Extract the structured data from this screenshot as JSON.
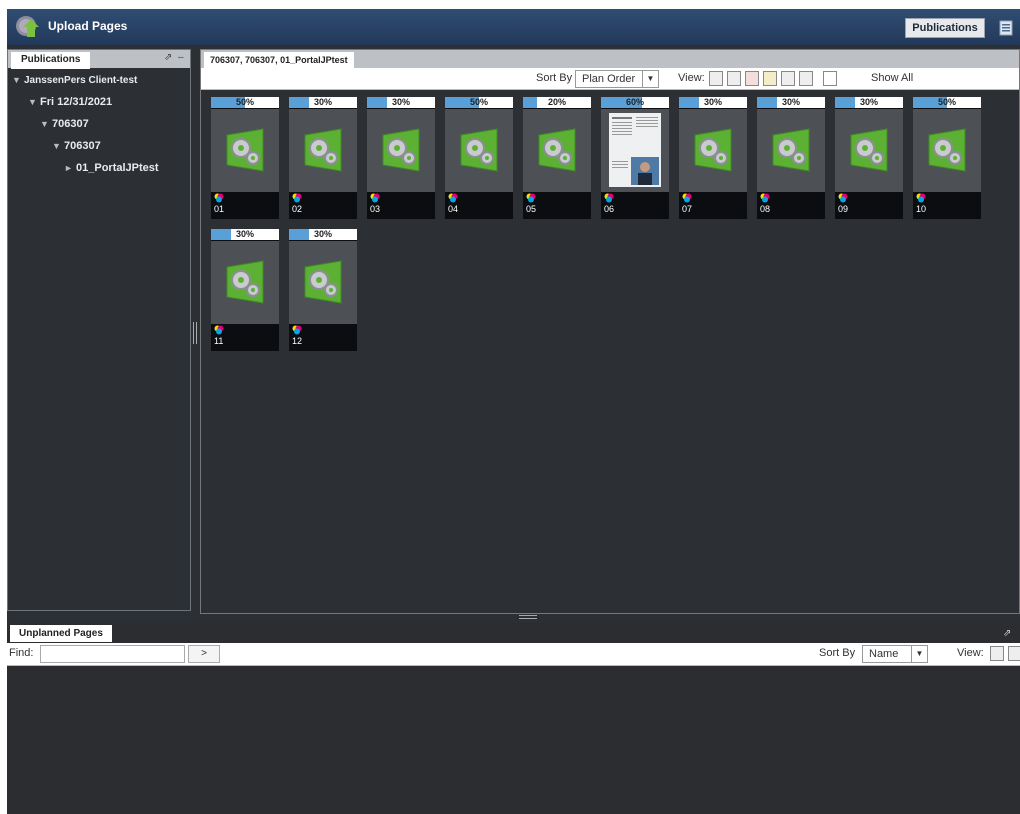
{
  "app": {
    "title": "Upload Pages",
    "publications_button": "Publications"
  },
  "left_panel": {
    "tab": "Publications",
    "tree": [
      {
        "label": "JanssenPers Client-test",
        "level": 0,
        "toggle": "▼"
      },
      {
        "label": "Fri 12/31/2021",
        "level": 1,
        "toggle": "▼"
      },
      {
        "label": "706307",
        "level": 2,
        "toggle": "▼"
      },
      {
        "label": "706307",
        "level": 3,
        "toggle": "▼"
      },
      {
        "label": "01_PortalJPtest",
        "level": 4,
        "toggle": "►"
      }
    ]
  },
  "center": {
    "tab": "706307, 706307, 01_PortalJPtest",
    "sort_label": "Sort By",
    "sort_value": "Plan Order",
    "view_label": "View:",
    "show_all": "Show All",
    "pages": [
      {
        "num": "01",
        "progress": "50%",
        "kind": "placeholder"
      },
      {
        "num": "02",
        "progress": "30%",
        "kind": "placeholder"
      },
      {
        "num": "03",
        "progress": "30%",
        "kind": "placeholder"
      },
      {
        "num": "04",
        "progress": "50%",
        "kind": "placeholder"
      },
      {
        "num": "05",
        "progress": "20%",
        "kind": "placeholder"
      },
      {
        "num": "06",
        "progress": "60%",
        "kind": "preview"
      },
      {
        "num": "07",
        "progress": "30%",
        "kind": "placeholder"
      },
      {
        "num": "08",
        "progress": "30%",
        "kind": "placeholder"
      },
      {
        "num": "09",
        "progress": "30%",
        "kind": "placeholder"
      },
      {
        "num": "10",
        "progress": "50%",
        "kind": "placeholder"
      },
      {
        "num": "11",
        "progress": "30%",
        "kind": "placeholder"
      },
      {
        "num": "12",
        "progress": "30%",
        "kind": "placeholder"
      }
    ]
  },
  "bottom": {
    "tab": "Unplanned Pages",
    "find_label": "Find:",
    "find_value": "",
    "go_label": ">",
    "sort_label": "Sort By",
    "sort_value": "Name",
    "view_label": "View:"
  },
  "colors": {
    "topbar": "#2f4d72",
    "progress": "#5aa0d8",
    "page_green": "#5cb135"
  }
}
